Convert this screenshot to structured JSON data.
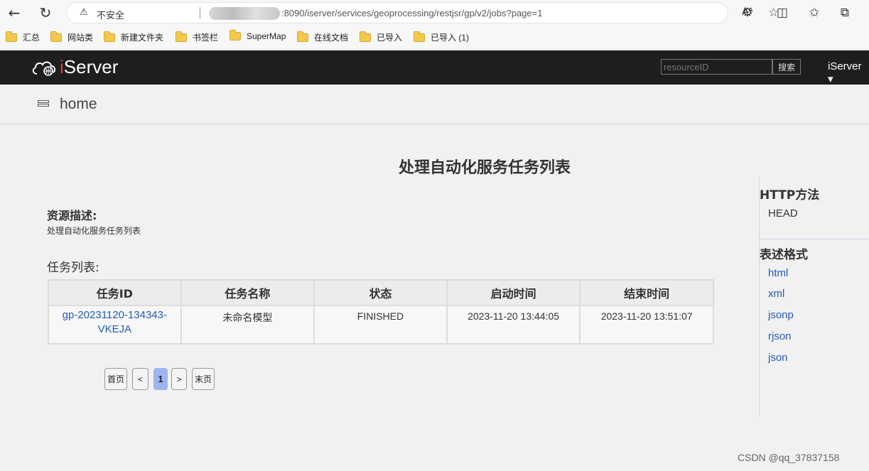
{
  "browser": {
    "back_icon": "←",
    "refresh_icon": "↻",
    "insecure_label": "不安全",
    "url": ":8090/iserver/services/geoprocessing/restjsr/gp/v2/jobs?page=1",
    "read_aloud_icon": "Aᴬ",
    "favorite_icon": "☆"
  },
  "bookmarks": [
    {
      "label": "汇总"
    },
    {
      "label": "网站类"
    },
    {
      "label": "新建文件夹"
    },
    {
      "label": "书签栏"
    },
    {
      "label": "SuperMap"
    },
    {
      "label": "在线文档"
    },
    {
      "label": "已导入"
    },
    {
      "label": "已导入 (1)"
    }
  ],
  "header": {
    "logo_i": "i",
    "logo_text": "Server",
    "search_placeholder": "resourceID",
    "search_button": "搜索",
    "user_menu": "iServer ▾"
  },
  "breadcrumb": {
    "label": "home"
  },
  "main": {
    "title": "处理自动化服务任务列表",
    "resource_desc_title": "资源描述:",
    "resource_desc": "处理自动化服务任务列表",
    "task_list_title": "任务列表:",
    "columns": [
      "任务ID",
      "任务名称",
      "状态",
      "启动时间",
      "结束时间"
    ],
    "rows": [
      {
        "id_line1": "gp-20231120-134343-",
        "id_line2": "VKEJA",
        "name": "未命名模型",
        "status": "FINISHED",
        "start": "2023-11-20 13:44:05",
        "end": "2023-11-20 13:51:07"
      }
    ],
    "pager": {
      "first": "首页",
      "prev": "<",
      "current": "1",
      "next": ">",
      "last": "末页"
    }
  },
  "sidebar": {
    "http_methods_title": "HTTP方法",
    "http_methods": [
      "HEAD"
    ],
    "formats_title": "表述格式",
    "formats": [
      "html",
      "xml",
      "jsonp",
      "rjson",
      "json"
    ]
  },
  "watermark": "CSDN @qq_37837158",
  "colors": {
    "header_bg": "#1e1e1e",
    "link": "#2559b8",
    "pager_active": "#9fb4ee",
    "logo_accent": "#e03a3a"
  }
}
